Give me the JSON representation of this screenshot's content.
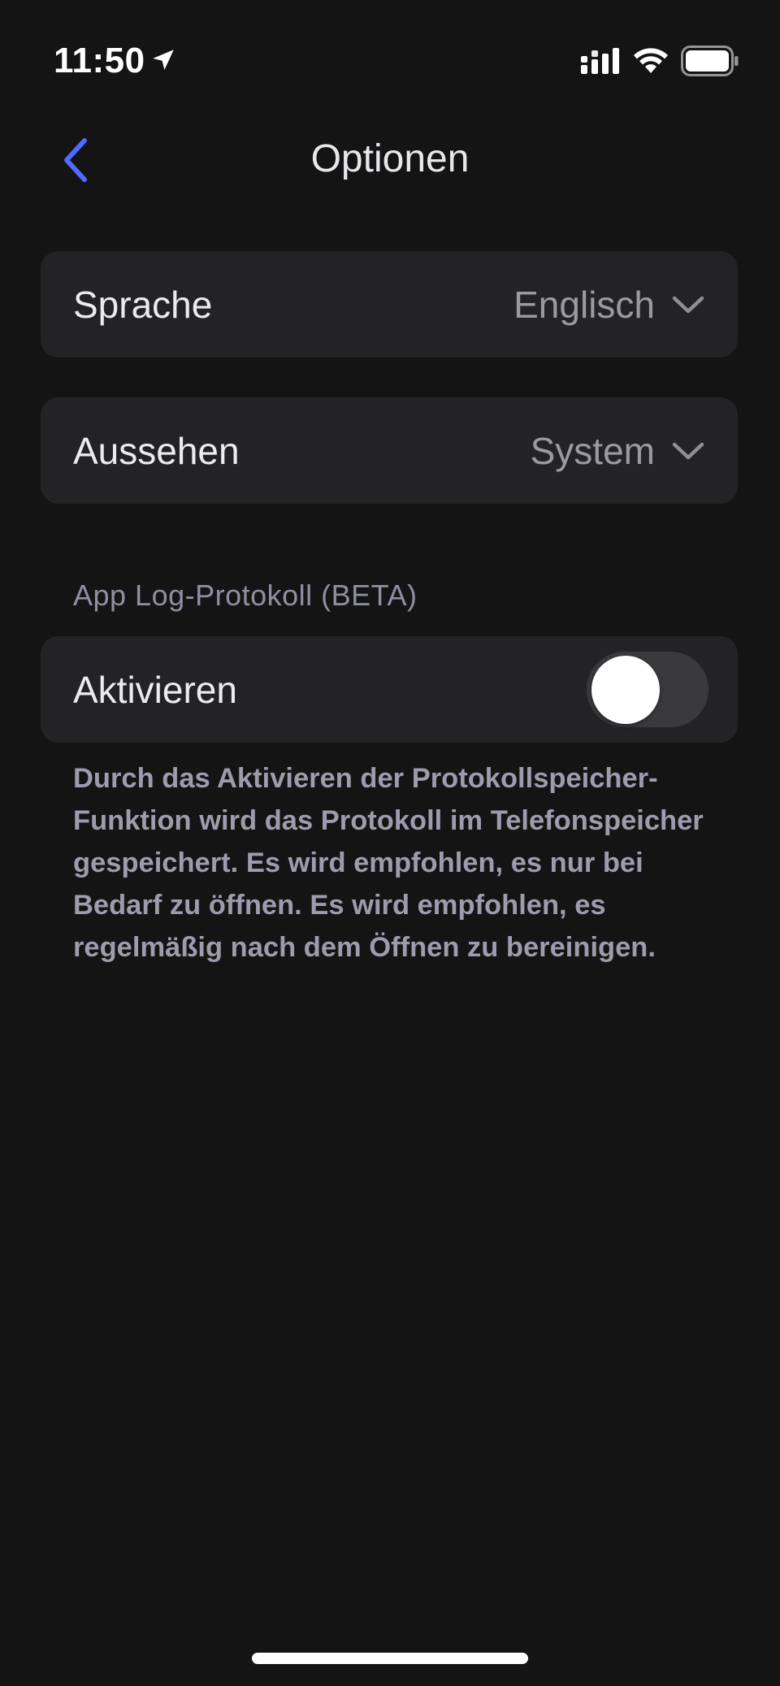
{
  "status_bar": {
    "time": "11:50",
    "icons": [
      "location-arrow-icon",
      "signal-icon",
      "wifi-icon",
      "battery-icon"
    ]
  },
  "nav": {
    "title": "Optionen",
    "back_icon": "chevron-left-icon"
  },
  "settings": {
    "language": {
      "label": "Sprache",
      "value": "Englisch"
    },
    "appearance": {
      "label": "Aussehen",
      "value": "System"
    }
  },
  "log_section": {
    "header": "App Log-Protokoll (BETA)",
    "enable_label": "Aktivieren",
    "enabled": false,
    "description": "Durch das Aktivieren der Protokollspeicher-Funktion wird das Protokoll im Telefonspeicher gespeichert. Es wird empfohlen, es nur bei Bedarf zu öffnen. Es wird empfohlen, es regelmäßig nach dem Öffnen zu bereinigen."
  },
  "colors": {
    "background": "#141415",
    "row_background": "#232325",
    "accent": "#4f6bff",
    "secondary_text": "#9c9cad"
  }
}
